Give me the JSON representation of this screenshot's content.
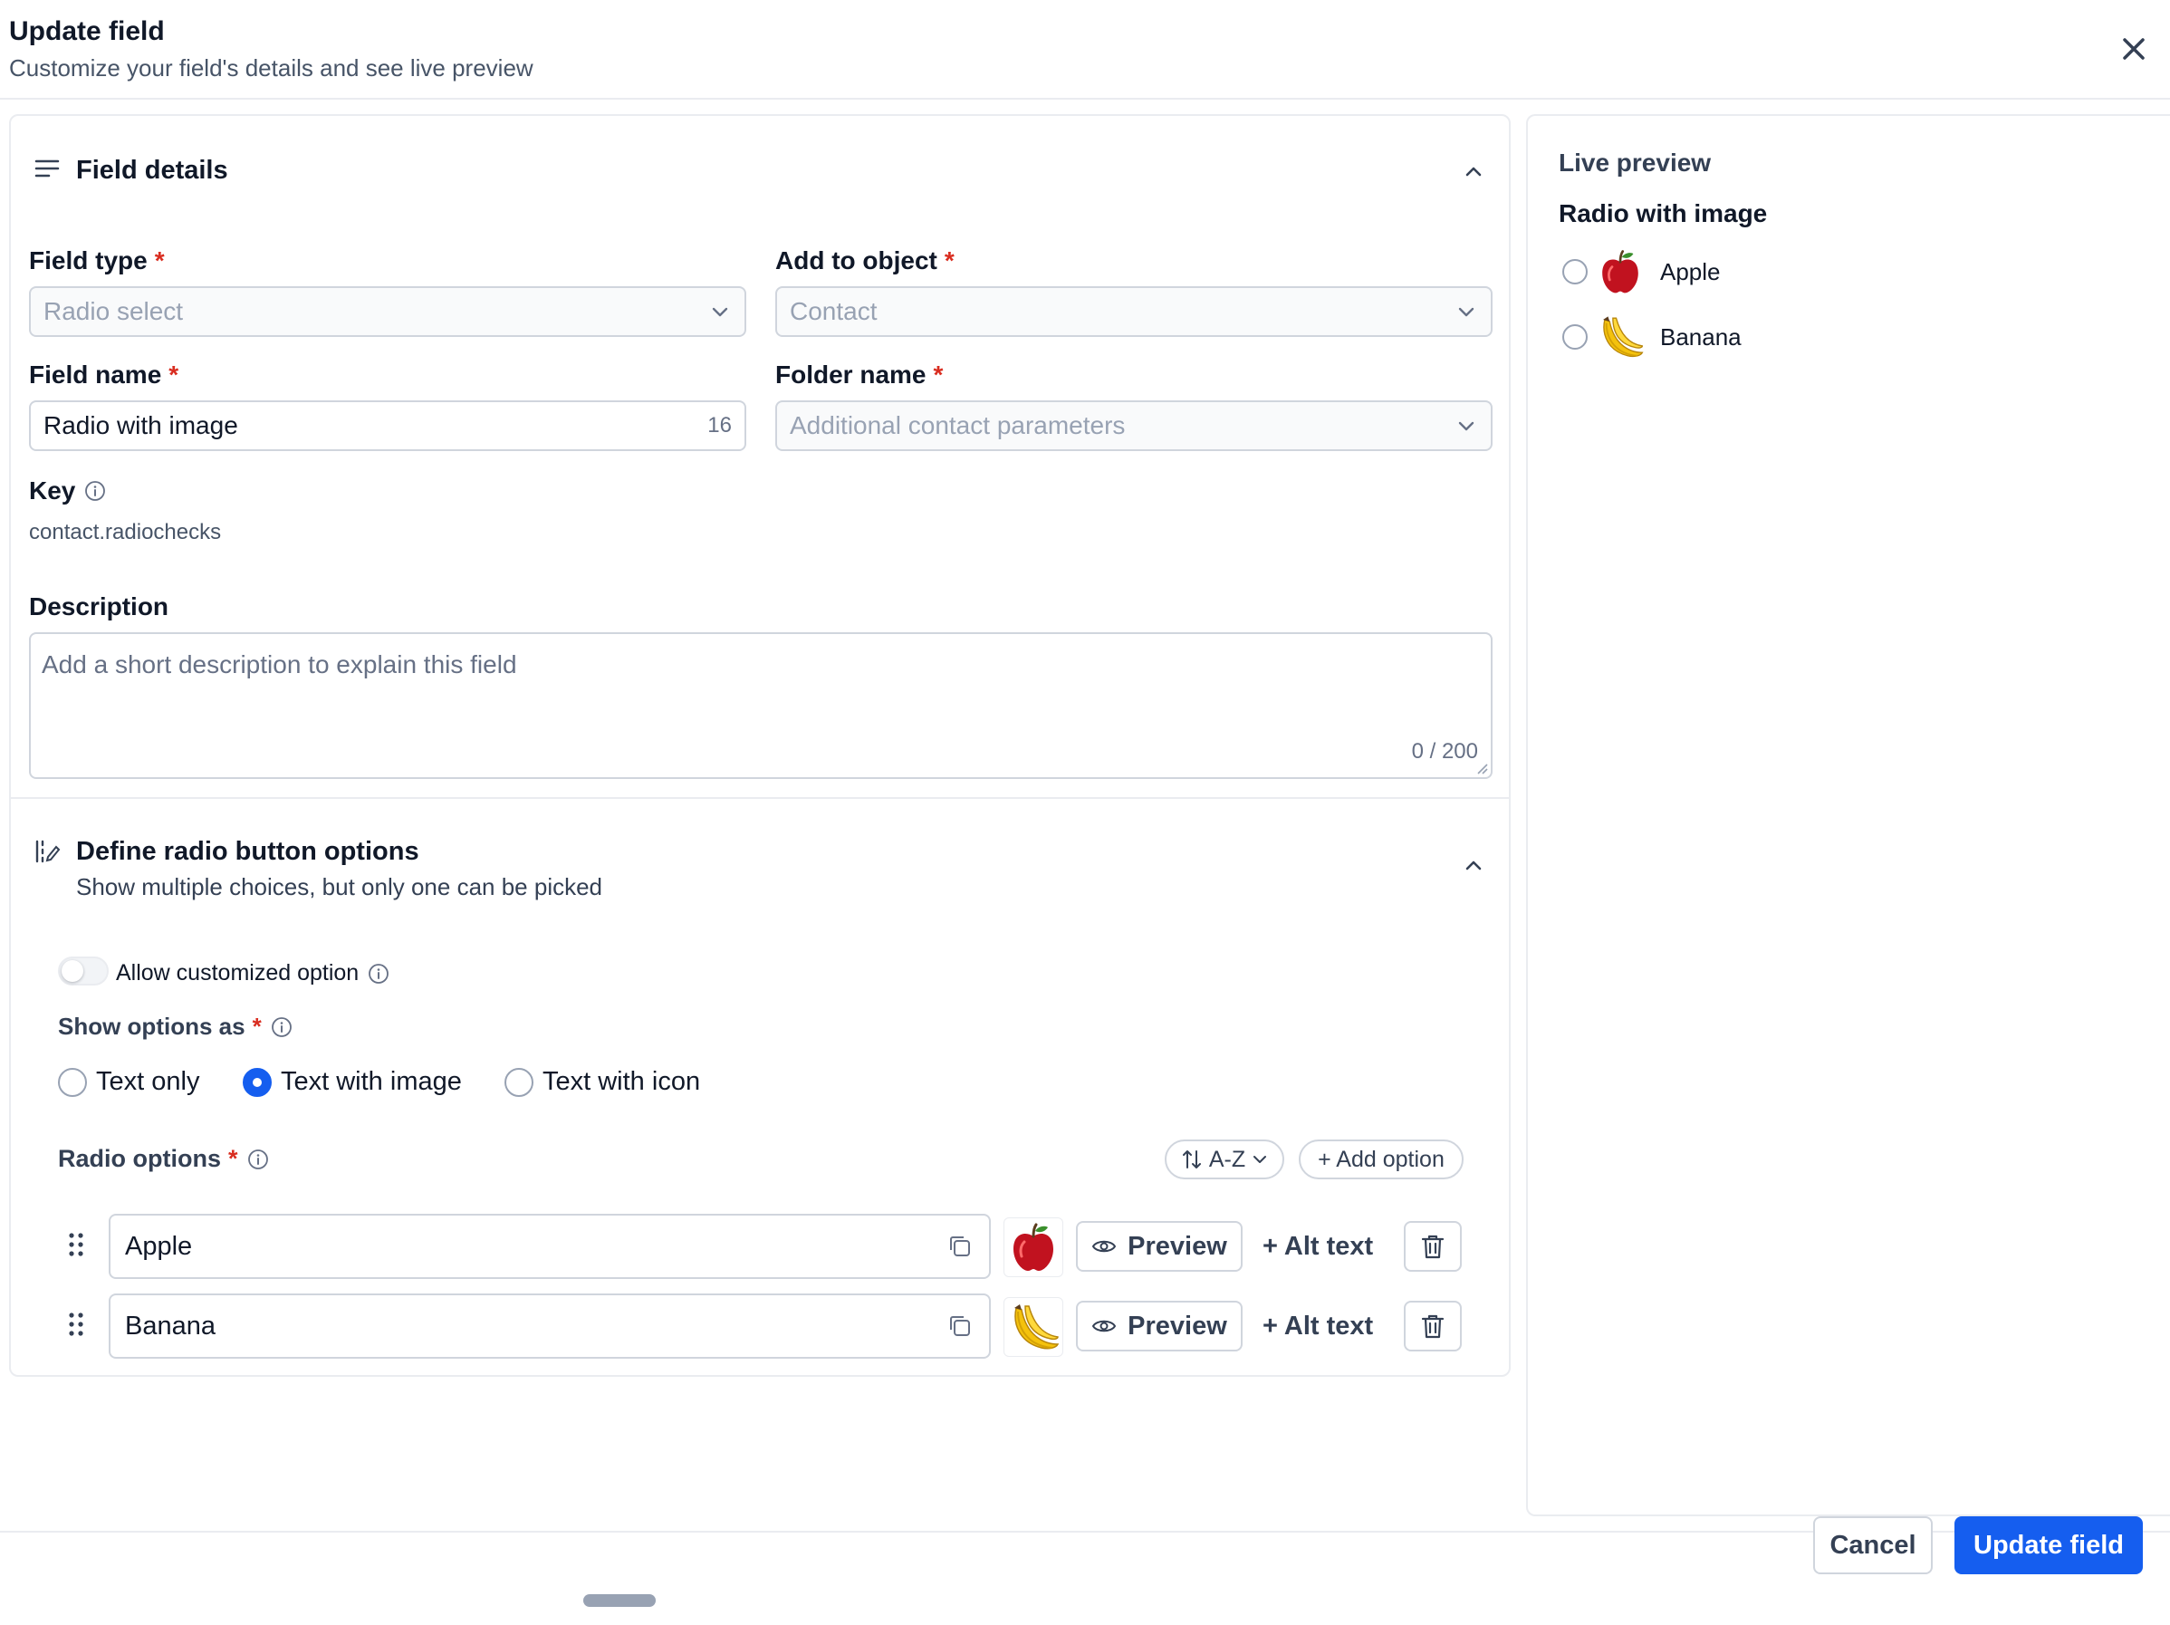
{
  "header": {
    "title": "Update field",
    "subtitle": "Customize your field's details and see live preview"
  },
  "field_details": {
    "title": "Field details",
    "field_type": {
      "label": "Field type",
      "value": "Radio select"
    },
    "add_to_object": {
      "label": "Add to object",
      "value": "Contact"
    },
    "field_name": {
      "label": "Field name",
      "value": "Radio with image",
      "count": "16"
    },
    "folder_name": {
      "label": "Folder name",
      "placeholder": "Additional contact parameters"
    },
    "key": {
      "label": "Key",
      "value": "contact.radiochecks"
    },
    "description": {
      "label": "Description",
      "placeholder": "Add a short description to explain this field",
      "counter": "0 / 200"
    }
  },
  "radio_options_section": {
    "title": "Define radio button options",
    "subtitle": "Show multiple choices, but only one can be picked",
    "allow_custom_label": "Allow customized option",
    "allow_custom_enabled": false,
    "show_as_label": "Show options as",
    "show_as_choices": [
      "Text only",
      "Text with image",
      "Text with icon"
    ],
    "show_as_selected": "Text with image",
    "options_label": "Radio options",
    "sort_label": "A-Z",
    "add_option_label": "+ Add option",
    "preview_label": "Preview",
    "alt_text_label": "+ Alt text",
    "options": [
      {
        "label": "Apple",
        "image": "apple"
      },
      {
        "label": "Banana",
        "image": "banana"
      }
    ]
  },
  "live_preview": {
    "title": "Live preview",
    "field_name": "Radio with image",
    "options": [
      "Apple",
      "Banana"
    ]
  },
  "footer": {
    "cancel_label": "Cancel",
    "update_label": "Update field"
  },
  "colors": {
    "primary": "#155eef",
    "required": "#d92d20",
    "border": "#d0d5dd"
  }
}
